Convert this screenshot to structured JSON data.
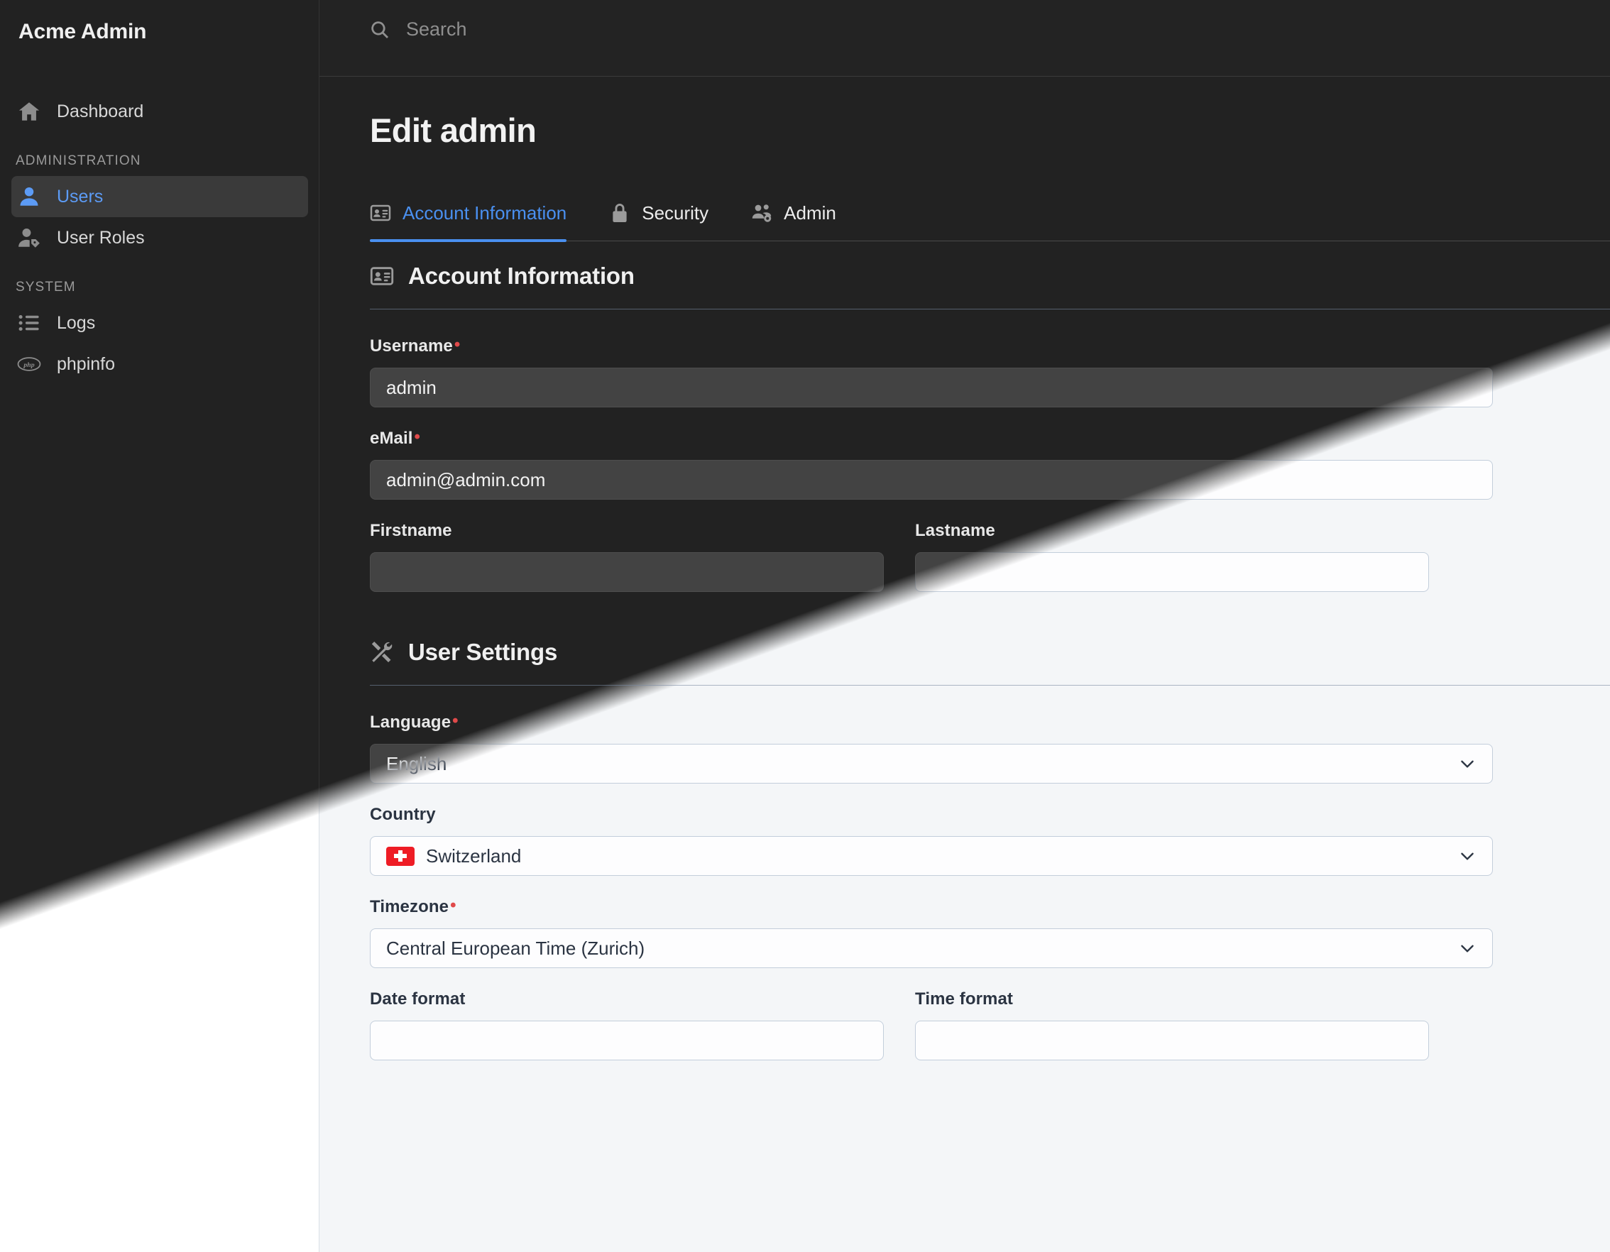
{
  "app": {
    "brand": "Acme Admin",
    "theme_accent": "#4a90f0",
    "required_marker_color": "#e04a4a"
  },
  "search": {
    "placeholder": "Search",
    "value": "",
    "icon": "search-icon"
  },
  "sidebar": {
    "items": [
      {
        "label": "Dashboard",
        "icon": "home-icon",
        "active": false,
        "section": null
      },
      {
        "label": "Users",
        "icon": "user-icon",
        "active": true,
        "section": "ADMINISTRATION"
      },
      {
        "label": "User Roles",
        "icon": "user-tag-icon",
        "active": false,
        "section": "ADMINISTRATION"
      },
      {
        "label": "Logs",
        "icon": "list-icon",
        "active": false,
        "section": "SYSTEM"
      },
      {
        "label": "phpinfo",
        "icon": "php-icon",
        "active": false,
        "section": "SYSTEM"
      }
    ],
    "sections": {
      "administration": "ADMINISTRATION",
      "system": "SYSTEM"
    }
  },
  "page": {
    "title": "Edit admin",
    "tabs": [
      {
        "label": "Account Information",
        "icon": "id-card-icon",
        "active": true
      },
      {
        "label": "Security",
        "icon": "lock-icon",
        "active": false
      },
      {
        "label": "Admin",
        "icon": "users-gear-icon",
        "active": false
      }
    ]
  },
  "account_information": {
    "heading": "Account Information",
    "heading_icon": "id-card-icon",
    "fields": {
      "username": {
        "label": "Username",
        "required": true,
        "value": "admin"
      },
      "email": {
        "label": "eMail",
        "required": true,
        "value": "admin@admin.com"
      },
      "firstname": {
        "label": "Firstname",
        "required": false,
        "value": ""
      },
      "lastname": {
        "label": "Lastname",
        "required": false,
        "value": ""
      }
    }
  },
  "user_settings": {
    "heading": "User Settings",
    "heading_icon": "tools-icon",
    "fields": {
      "language": {
        "label": "Language",
        "required": true,
        "value": "English"
      },
      "country": {
        "label": "Country",
        "required": false,
        "value": "Switzerland",
        "flag": "switzerland-flag"
      },
      "timezone": {
        "label": "Timezone",
        "required": true,
        "value": "Central European Time (Zurich)"
      },
      "date_format": {
        "label": "Date format",
        "required": false,
        "value": ""
      },
      "time_format": {
        "label": "Time format",
        "required": false,
        "value": ""
      }
    }
  }
}
